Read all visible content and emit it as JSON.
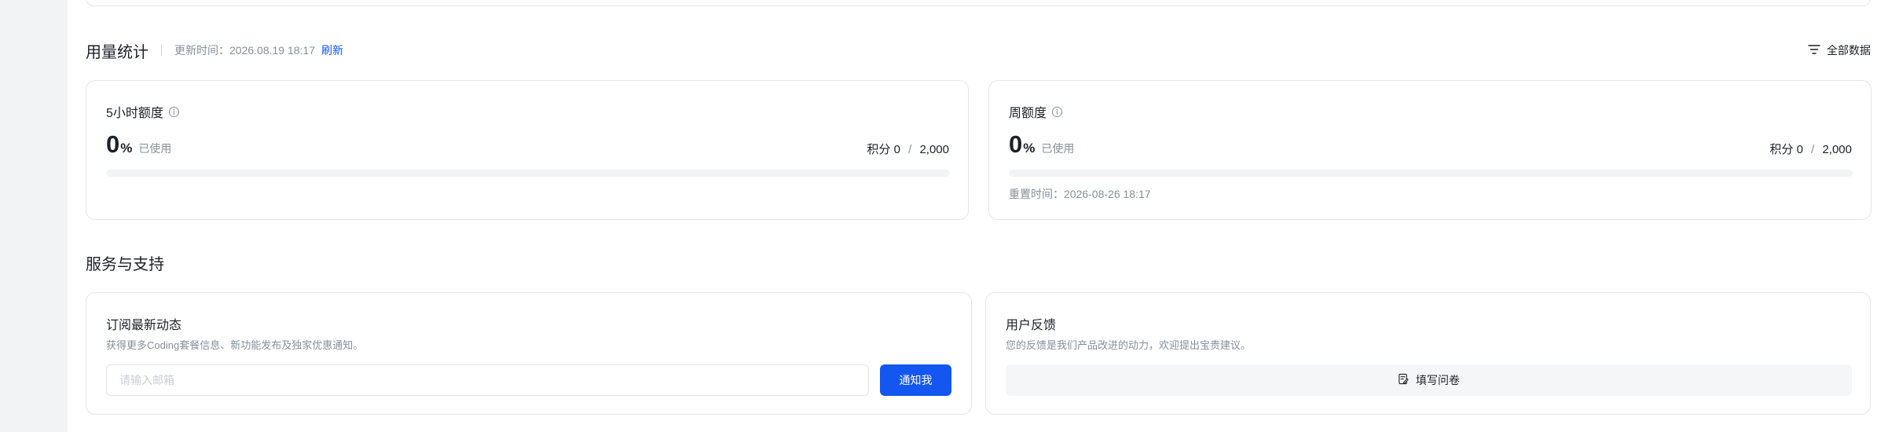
{
  "usage": {
    "title": "用量统计",
    "update_label": "更新时间：",
    "update_time": "2026.08.19 18:17",
    "refresh_label": "刷新",
    "filter_label": "全部数据"
  },
  "quota_cards": [
    {
      "title": "5小时额度",
      "percent": "0",
      "percent_unit": "%",
      "used_label": "已使用",
      "points_label": "积分",
      "points_used": "0",
      "points_sep": "/",
      "points_total": "2,000",
      "progress_fraction": 0
    },
    {
      "title": "周额度",
      "percent": "0",
      "percent_unit": "%",
      "used_label": "已使用",
      "points_label": "积分",
      "points_used": "0",
      "points_sep": "/",
      "points_total": "2,000",
      "progress_fraction": 0,
      "reset_label": "重置时间：",
      "reset_time": "2026-08-26 18:17"
    }
  ],
  "services": {
    "title": "服务与支持",
    "subscribe": {
      "title": "订阅最新动态",
      "description": "获得更多Coding套餐信息、新功能发布及独家优惠通知。",
      "email_placeholder": "请输入邮箱",
      "email_value": "",
      "button_label": "通知我"
    },
    "feedback": {
      "title": "用户反馈",
      "description": "您的反馈是我们产品改进的动力，欢迎提出宝贵建议。",
      "button_label": "填写问卷"
    }
  },
  "icons": {
    "filter": "filter-lines-icon",
    "info": "info-circle-icon",
    "survey": "edit-form-icon",
    "assistant": "assistant-face-icon"
  },
  "colors": {
    "accent": "#1456f0",
    "text_primary": "#1d2129",
    "text_secondary": "#86909c",
    "border": "#e5e6eb",
    "progress_track": "#f2f3f5"
  }
}
